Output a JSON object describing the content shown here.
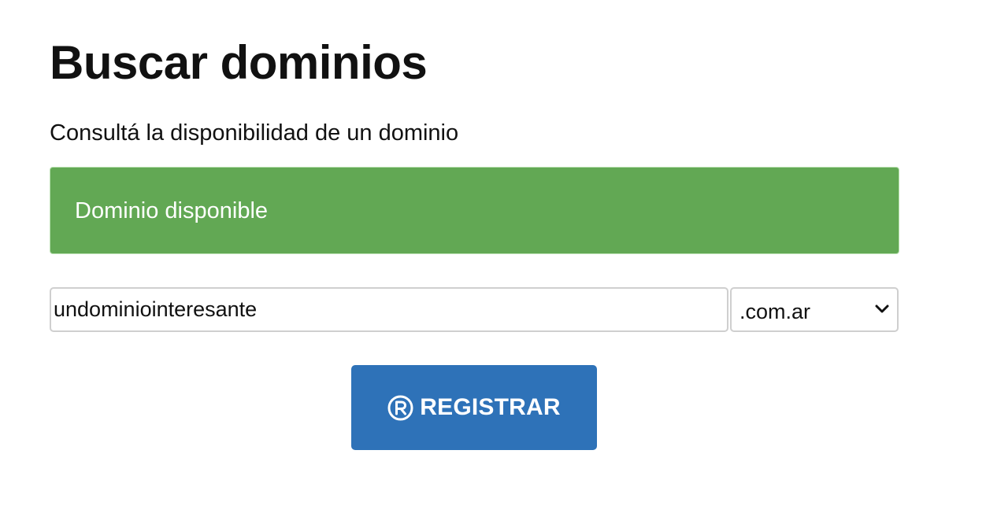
{
  "header": {
    "title": "Buscar dominios",
    "subtitle": "Consultá la disponibilidad de un dominio"
  },
  "status": {
    "message": "Dominio disponible",
    "color": "#62a854"
  },
  "search": {
    "domain_value": "undominiointeresante",
    "tld_selected": ".com.ar"
  },
  "actions": {
    "register_label": "REGISTRAR",
    "register_icon": "registered-icon",
    "register_color": "#2e72b8"
  }
}
